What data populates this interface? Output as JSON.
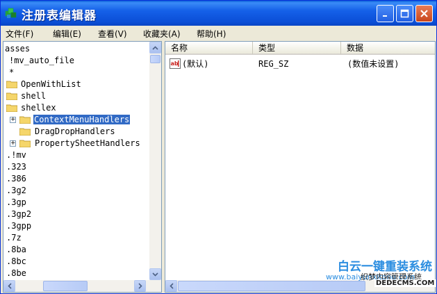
{
  "window": {
    "title": "注册表编辑器"
  },
  "menu": [
    "文件(F)",
    "编辑(E)",
    "查看(V)",
    "收藏夹(A)",
    "帮助(H)"
  ],
  "tree": [
    {
      "label": "asses"
    },
    {
      "label": "!mv_auto_file"
    },
    {
      "label": "*"
    },
    {
      "label": "OpenWithList"
    },
    {
      "label": "shell"
    },
    {
      "label": "shellex"
    },
    {
      "label": "ContextMenuHandlers"
    },
    {
      "label": "DragDropHandlers"
    },
    {
      "label": "PropertySheetHandlers"
    },
    {
      "label": ".!mv"
    },
    {
      "label": ".323"
    },
    {
      "label": ".386"
    },
    {
      "label": ".3g2"
    },
    {
      "label": ".3gp"
    },
    {
      "label": ".3gp2"
    },
    {
      "label": ".3gpp"
    },
    {
      "label": ".7z"
    },
    {
      "label": ".8ba"
    },
    {
      "label": ".8bc"
    },
    {
      "label": ".8be"
    }
  ],
  "values_table": {
    "headers": [
      "名称",
      "类型",
      "数据"
    ],
    "rows": [
      {
        "name": "(默认)",
        "type": "REG_SZ",
        "data": "(数值未设置)"
      }
    ]
  },
  "watermark": {
    "brand": "白云一键重装系统",
    "url": "www.baiyunxitong.com",
    "overlay": "织梦内容管理系统",
    "dede": "DEDECMS.COM"
  }
}
